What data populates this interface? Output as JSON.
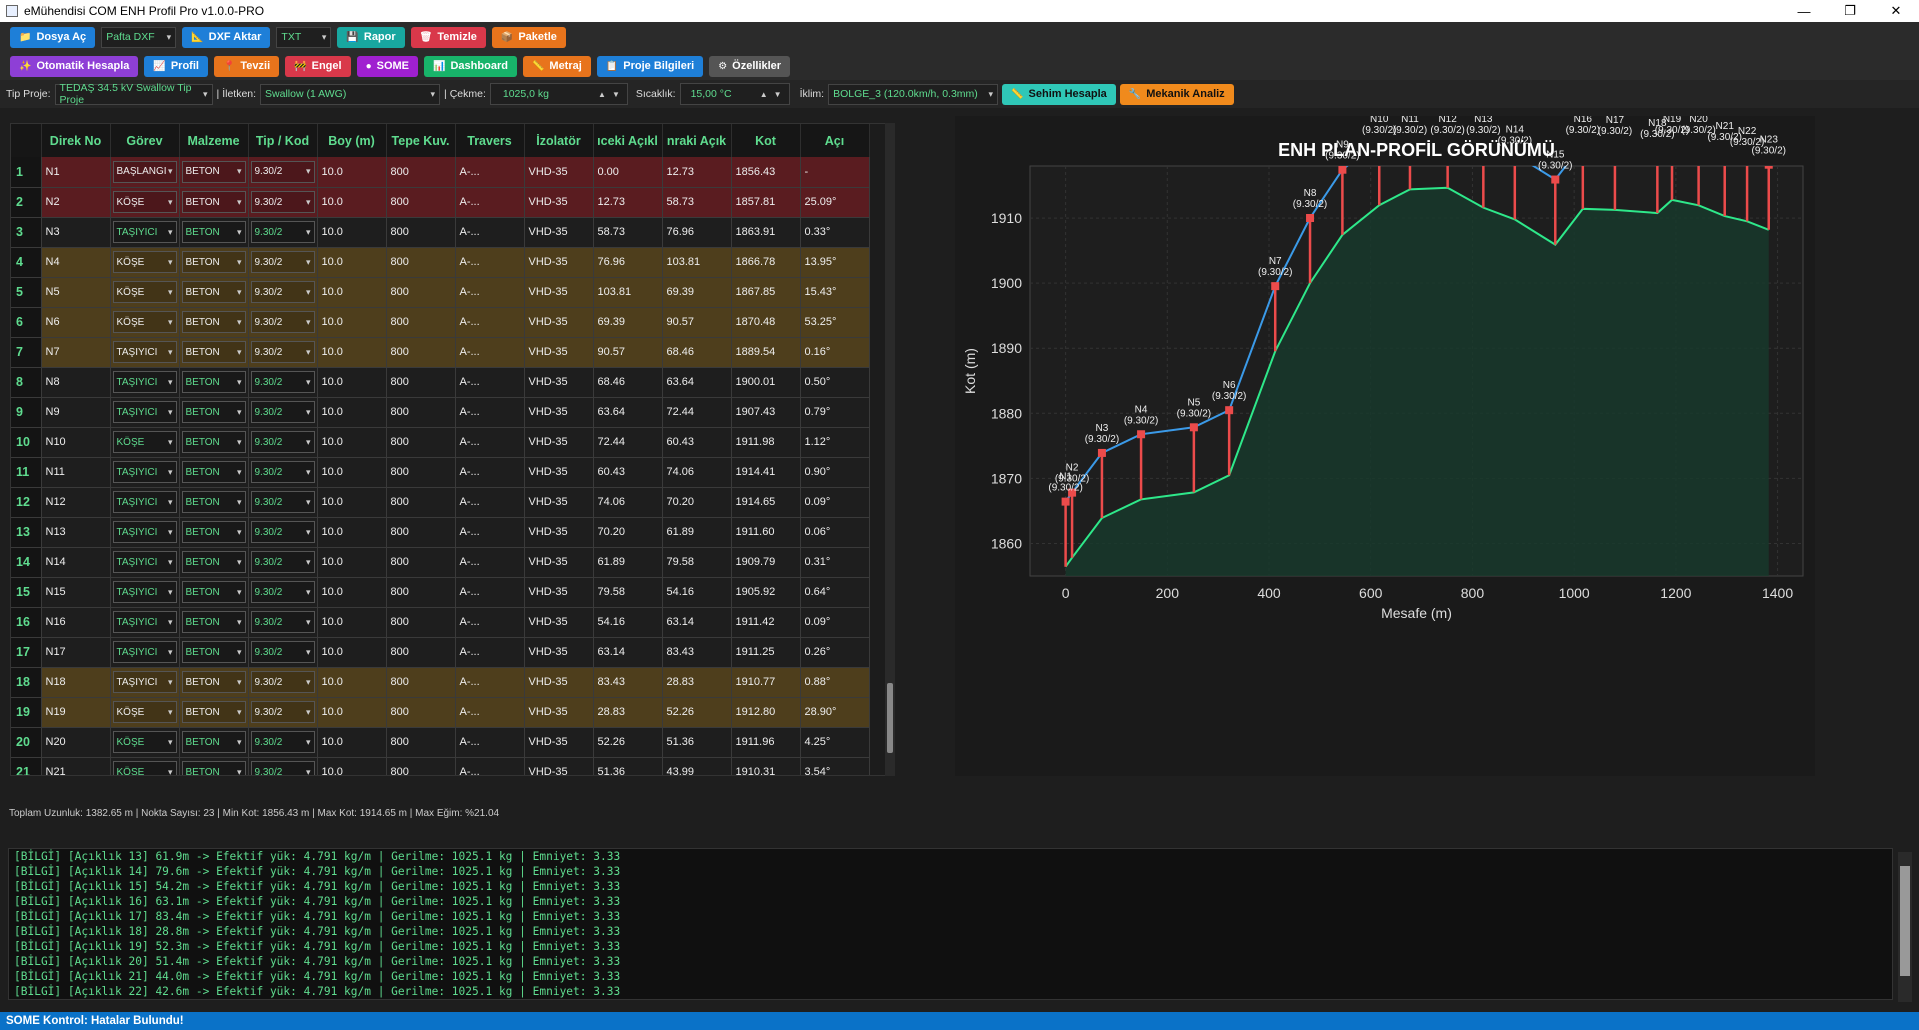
{
  "window": {
    "title": "eMühendisi COM ENH Profil Pro v1.0.0-PRO"
  },
  "toolbar1": [
    {
      "name": "dosya-ac-button",
      "label": "Dosya Aç",
      "icon": "folder-icon",
      "glyph": "📁",
      "color": "#1e7fd8"
    },
    {
      "name": "pafta-combo",
      "label": "Pafta DXF",
      "combo": true,
      "w": 75
    },
    {
      "name": "dxf-aktar-button",
      "label": "DXF Aktar",
      "icon": "drafting-icon",
      "glyph": "📐",
      "color": "#1e7fd8"
    },
    {
      "name": "txt-combo",
      "label": "TXT",
      "combo": true,
      "w": 55
    },
    {
      "name": "rapor-button",
      "label": "Rapor",
      "icon": "save-icon",
      "glyph": "💾",
      "color": "#18a7a0"
    },
    {
      "name": "temizle-button",
      "label": "Temizle",
      "icon": "trash-icon",
      "glyph": "🗑",
      "color": "#d9384a"
    },
    {
      "name": "paketle-button",
      "label": "Paketle",
      "icon": "package-icon",
      "glyph": "📦",
      "color": "#e8741c"
    }
  ],
  "toolbar2": [
    {
      "name": "otomatik-hesapla-button",
      "label": "Otomatik Hesapla",
      "icon": "magic-icon",
      "glyph": "✨",
      "color": "#8e3fd6"
    },
    {
      "name": "profil-button",
      "label": "Profil",
      "icon": "chart-icon",
      "glyph": "📈",
      "color": "#1e7fd8"
    },
    {
      "name": "tevzii-button",
      "label": "Tevzii",
      "icon": "pin-icon",
      "glyph": "📍",
      "color": "#e8741c"
    },
    {
      "name": "engel-button",
      "label": "Engel",
      "icon": "barrier-icon",
      "glyph": "🚧",
      "color": "#d9384a"
    },
    {
      "name": "some-button",
      "label": "SOME",
      "icon": "dot-icon",
      "glyph": "●",
      "color": "#a020d0"
    },
    {
      "name": "dashboard-button",
      "label": "Dashboard",
      "icon": "dashboard-icon",
      "glyph": "📊",
      "color": "#18b46a"
    },
    {
      "name": "metraj-button",
      "label": "Metraj",
      "icon": "ruler-icon",
      "glyph": "📏",
      "color": "#e8741c"
    },
    {
      "name": "proje-bilgileri-button",
      "label": "Proje Bilgileri",
      "icon": "clipboard-icon",
      "glyph": "📋",
      "color": "#1e7fd8"
    },
    {
      "name": "ozellikler-button",
      "label": "Özellikler",
      "icon": "gear-icon",
      "glyph": "⚙",
      "color": "#555555"
    }
  ],
  "params": {
    "tip_proje_label": "Tip Proje:",
    "tip_proje_value": "TEDAŞ 34.5 kV Swallow Tip Proje",
    "iletken_label": "| İletken:",
    "iletken_value": "Swallow (1 AWG)",
    "cekme_label": "| Çekme:",
    "cekme_value": "1025,0 kg",
    "sicaklik_label": "Sıcaklık:",
    "sicaklik_value": "15,00 °C",
    "iklim_label": "İklim:",
    "iklim_value": "BOLGE_3 (120.0km/h, 0.3mm)",
    "sehim_label": "Sehim Hesapla",
    "mekanik_label": "Mekanik Analiz"
  },
  "table": {
    "headers": [
      "",
      "Direk No",
      "Görev",
      "Malzeme",
      "Tip / Kod",
      "Boy (m)",
      "Tepe Kuv.",
      "Travers",
      "İzolatör",
      "ıceki Açıkl",
      "nraki Açık",
      "Kot",
      "Açı"
    ],
    "rows": [
      {
        "n": "1",
        "id": "N1",
        "gorev": "BAŞLANGI",
        "mal": "BETON",
        "tip": "9.30/2",
        "boy": "10.0",
        "tepe": "800",
        "trav": "A-...",
        "izo": "VHD-35",
        "onc": "0.00",
        "son": "12.73",
        "kot": "1856.43",
        "aci": "-",
        "c": "red"
      },
      {
        "n": "2",
        "id": "N2",
        "gorev": "KÖŞE",
        "mal": "BETON",
        "tip": "9.30/2",
        "boy": "10.0",
        "tepe": "800",
        "trav": "A-...",
        "izo": "VHD-35",
        "onc": "12.73",
        "son": "58.73",
        "kot": "1857.81",
        "aci": "25.09°",
        "c": "red"
      },
      {
        "n": "3",
        "id": "N3",
        "gorev": "TAŞIYICI",
        "mal": "BETON",
        "tip": "9.30/2",
        "boy": "10.0",
        "tepe": "800",
        "trav": "A-...",
        "izo": "VHD-35",
        "onc": "58.73",
        "son": "76.96",
        "kot": "1863.91",
        "aci": "0.33°",
        "c": "dark"
      },
      {
        "n": "4",
        "id": "N4",
        "gorev": "KÖŞE",
        "mal": "BETON",
        "tip": "9.30/2",
        "boy": "10.0",
        "tepe": "800",
        "trav": "A-...",
        "izo": "VHD-35",
        "onc": "76.96",
        "son": "103.81",
        "kot": "1866.78",
        "aci": "13.95°",
        "c": "amber"
      },
      {
        "n": "5",
        "id": "N5",
        "gorev": "KÖŞE",
        "mal": "BETON",
        "tip": "9.30/2",
        "boy": "10.0",
        "tepe": "800",
        "trav": "A-...",
        "izo": "VHD-35",
        "onc": "103.81",
        "son": "69.39",
        "kot": "1867.85",
        "aci": "15.43°",
        "c": "amber"
      },
      {
        "n": "6",
        "id": "N6",
        "gorev": "KÖŞE",
        "mal": "BETON",
        "tip": "9.30/2",
        "boy": "10.0",
        "tepe": "800",
        "trav": "A-...",
        "izo": "VHD-35",
        "onc": "69.39",
        "son": "90.57",
        "kot": "1870.48",
        "aci": "53.25°",
        "c": "amber"
      },
      {
        "n": "7",
        "id": "N7",
        "gorev": "TAŞIYICI",
        "mal": "BETON",
        "tip": "9.30/2",
        "boy": "10.0",
        "tepe": "800",
        "trav": "A-...",
        "izo": "VHD-35",
        "onc": "90.57",
        "son": "68.46",
        "kot": "1889.54",
        "aci": "0.16°",
        "c": "amber"
      },
      {
        "n": "8",
        "id": "N8",
        "gorev": "TAŞIYICI",
        "mal": "BETON",
        "tip": "9.30/2",
        "boy": "10.0",
        "tepe": "800",
        "trav": "A-...",
        "izo": "VHD-35",
        "onc": "68.46",
        "son": "63.64",
        "kot": "1900.01",
        "aci": "0.50°",
        "c": "dark"
      },
      {
        "n": "9",
        "id": "N9",
        "gorev": "TAŞIYICI",
        "mal": "BETON",
        "tip": "9.30/2",
        "boy": "10.0",
        "tepe": "800",
        "trav": "A-...",
        "izo": "VHD-35",
        "onc": "63.64",
        "son": "72.44",
        "kot": "1907.43",
        "aci": "0.79°",
        "c": "dark"
      },
      {
        "n": "10",
        "id": "N10",
        "gorev": "KÖŞE",
        "mal": "BETON",
        "tip": "9.30/2",
        "boy": "10.0",
        "tepe": "800",
        "trav": "A-...",
        "izo": "VHD-35",
        "onc": "72.44",
        "son": "60.43",
        "kot": "1911.98",
        "aci": "1.12°",
        "c": "dark"
      },
      {
        "n": "11",
        "id": "N11",
        "gorev": "TAŞIYICI",
        "mal": "BETON",
        "tip": "9.30/2",
        "boy": "10.0",
        "tepe": "800",
        "trav": "A-...",
        "izo": "VHD-35",
        "onc": "60.43",
        "son": "74.06",
        "kot": "1914.41",
        "aci": "0.90°",
        "c": "dark"
      },
      {
        "n": "12",
        "id": "N12",
        "gorev": "TAŞIYICI",
        "mal": "BETON",
        "tip": "9.30/2",
        "boy": "10.0",
        "tepe": "800",
        "trav": "A-...",
        "izo": "VHD-35",
        "onc": "74.06",
        "son": "70.20",
        "kot": "1914.65",
        "aci": "0.09°",
        "c": "dark"
      },
      {
        "n": "13",
        "id": "N13",
        "gorev": "TAŞIYICI",
        "mal": "BETON",
        "tip": "9.30/2",
        "boy": "10.0",
        "tepe": "800",
        "trav": "A-...",
        "izo": "VHD-35",
        "onc": "70.20",
        "son": "61.89",
        "kot": "1911.60",
        "aci": "0.06°",
        "c": "dark"
      },
      {
        "n": "14",
        "id": "N14",
        "gorev": "TAŞIYICI",
        "mal": "BETON",
        "tip": "9.30/2",
        "boy": "10.0",
        "tepe": "800",
        "trav": "A-...",
        "izo": "VHD-35",
        "onc": "61.89",
        "son": "79.58",
        "kot": "1909.79",
        "aci": "0.31°",
        "c": "dark"
      },
      {
        "n": "15",
        "id": "N15",
        "gorev": "TAŞIYICI",
        "mal": "BETON",
        "tip": "9.30/2",
        "boy": "10.0",
        "tepe": "800",
        "trav": "A-...",
        "izo": "VHD-35",
        "onc": "79.58",
        "son": "54.16",
        "kot": "1905.92",
        "aci": "0.64°",
        "c": "dark"
      },
      {
        "n": "16",
        "id": "N16",
        "gorev": "TAŞIYICI",
        "mal": "BETON",
        "tip": "9.30/2",
        "boy": "10.0",
        "tepe": "800",
        "trav": "A-...",
        "izo": "VHD-35",
        "onc": "54.16",
        "son": "63.14",
        "kot": "1911.42",
        "aci": "0.09°",
        "c": "dark"
      },
      {
        "n": "17",
        "id": "N17",
        "gorev": "TAŞIYICI",
        "mal": "BETON",
        "tip": "9.30/2",
        "boy": "10.0",
        "tepe": "800",
        "trav": "A-...",
        "izo": "VHD-35",
        "onc": "63.14",
        "son": "83.43",
        "kot": "1911.25",
        "aci": "0.26°",
        "c": "dark"
      },
      {
        "n": "18",
        "id": "N18",
        "gorev": "TAŞIYICI",
        "mal": "BETON",
        "tip": "9.30/2",
        "boy": "10.0",
        "tepe": "800",
        "trav": "A-...",
        "izo": "VHD-35",
        "onc": "83.43",
        "son": "28.83",
        "kot": "1910.77",
        "aci": "0.88°",
        "c": "amber"
      },
      {
        "n": "19",
        "id": "N19",
        "gorev": "KÖŞE",
        "mal": "BETON",
        "tip": "9.30/2",
        "boy": "10.0",
        "tepe": "800",
        "trav": "A-...",
        "izo": "VHD-35",
        "onc": "28.83",
        "son": "52.26",
        "kot": "1912.80",
        "aci": "28.90°",
        "c": "amber"
      },
      {
        "n": "20",
        "id": "N20",
        "gorev": "KÖŞE",
        "mal": "BETON",
        "tip": "9.30/2",
        "boy": "10.0",
        "tepe": "800",
        "trav": "A-...",
        "izo": "VHD-35",
        "onc": "52.26",
        "son": "51.36",
        "kot": "1911.96",
        "aci": "4.25°",
        "c": "dark"
      },
      {
        "n": "21",
        "id": "N21",
        "gorev": "KÖŞE",
        "mal": "BETON",
        "tip": "9.30/2",
        "boy": "10.0",
        "tepe": "800",
        "trav": "A-...",
        "izo": "VHD-35",
        "onc": "51.36",
        "son": "43.99",
        "kot": "1910.31",
        "aci": "3.54°",
        "c": "dark"
      }
    ]
  },
  "summary": "Toplam Uzunluk: 1382.65 m | Nokta Sayısı: 23 | Min Kot: 1856.43 m | Max Kot: 1914.65 m | Max Eğim: %21.04",
  "console": [
    "[BİLGİ] [Açıklık 13] 61.9m -> Efektif yük: 4.791 kg/m | Gerilme: 1025.1 kg | Emniyet: 3.33",
    "[BİLGİ] [Açıklık 14] 79.6m -> Efektif yük: 4.791 kg/m | Gerilme: 1025.1 kg | Emniyet: 3.33",
    "[BİLGİ] [Açıklık 15] 54.2m -> Efektif yük: 4.791 kg/m | Gerilme: 1025.1 kg | Emniyet: 3.33",
    "[BİLGİ] [Açıklık 16] 63.1m -> Efektif yük: 4.791 kg/m | Gerilme: 1025.1 kg | Emniyet: 3.33",
    "[BİLGİ] [Açıklık 17] 83.4m -> Efektif yük: 4.791 kg/m | Gerilme: 1025.1 kg | Emniyet: 3.33",
    "[BİLGİ] [Açıklık 18] 28.8m -> Efektif yük: 4.791 kg/m | Gerilme: 1025.1 kg | Emniyet: 3.33",
    "[BİLGİ] [Açıklık 19] 52.3m -> Efektif yük: 4.791 kg/m | Gerilme: 1025.1 kg | Emniyet: 3.33",
    "[BİLGİ] [Açıklık 20] 51.4m -> Efektif yük: 4.791 kg/m | Gerilme: 1025.1 kg | Emniyet: 3.33",
    "[BİLGİ] [Açıklık 21] 44.0m -> Efektif yük: 4.791 kg/m | Gerilme: 1025.1 kg | Emniyet: 3.33",
    "[BİLGİ] [Açıklık 22] 42.6m -> Efektif yük: 4.791 kg/m | Gerilme: 1025.1 kg | Emniyet: 3.33"
  ],
  "footer": "SOME Kontrol: Hatalar Bulundu!",
  "chart_data": {
    "type": "line",
    "title": "ENH PLAN-PROFİL GÖRÜNÜMÜ",
    "xlabel": "Mesafe (m)",
    "ylabel": "Kot (m)",
    "xlim": [
      -70,
      1450
    ],
    "ylim": [
      1855,
      1918
    ],
    "xticks": [
      0,
      200,
      400,
      600,
      800,
      1000,
      1200,
      1400
    ],
    "yticks": [
      1860,
      1870,
      1880,
      1890,
      1900,
      1910
    ],
    "pole_label": "(9.30/2)",
    "poles": [
      {
        "name": "N1",
        "x": 0,
        "ground": 1856.43
      },
      {
        "name": "N2",
        "x": 12.73,
        "ground": 1857.81
      },
      {
        "name": "N3",
        "x": 71.46,
        "ground": 1863.91
      },
      {
        "name": "N4",
        "x": 148.42,
        "ground": 1866.78
      },
      {
        "name": "N5",
        "x": 252.23,
        "ground": 1867.85
      },
      {
        "name": "N6",
        "x": 321.62,
        "ground": 1870.48
      },
      {
        "name": "N7",
        "x": 412.19,
        "ground": 1889.54
      },
      {
        "name": "N8",
        "x": 480.65,
        "ground": 1900.01
      },
      {
        "name": "N9",
        "x": 544.29,
        "ground": 1907.43
      },
      {
        "name": "N10",
        "x": 616.73,
        "ground": 1911.98
      },
      {
        "name": "N11",
        "x": 677.16,
        "ground": 1914.41
      },
      {
        "name": "N12",
        "x": 751.22,
        "ground": 1914.65
      },
      {
        "name": "N13",
        "x": 821.42,
        "ground": 1911.6
      },
      {
        "name": "N14",
        "x": 883.31,
        "ground": 1909.79
      },
      {
        "name": "N15",
        "x": 962.89,
        "ground": 1905.92
      },
      {
        "name": "N16",
        "x": 1017.05,
        "ground": 1911.42
      },
      {
        "name": "N17",
        "x": 1080.19,
        "ground": 1911.25
      },
      {
        "name": "N18",
        "x": 1163.62,
        "ground": 1910.77
      },
      {
        "name": "N19",
        "x": 1192.45,
        "ground": 1912.8
      },
      {
        "name": "N20",
        "x": 1244.71,
        "ground": 1911.96
      },
      {
        "name": "N21",
        "x": 1296.07,
        "ground": 1910.31
      },
      {
        "name": "N22",
        "x": 1340.06,
        "ground": 1909.5
      },
      {
        "name": "N23",
        "x": 1382.65,
        "ground": 1908.2
      }
    ],
    "colors": {
      "ground": "#2ee88a",
      "conductor": "#3b9ae8",
      "pole": "#ec4b4b",
      "fill": "#163a2c",
      "bg": "#1a1a1a",
      "plotbg": "#1e1e1e"
    }
  }
}
